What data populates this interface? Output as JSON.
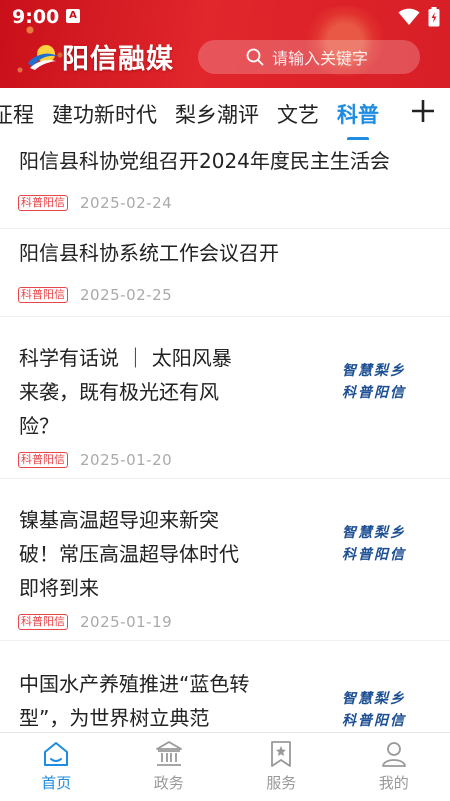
{
  "status_bar": {
    "time": "9:00",
    "notification_badge": "A"
  },
  "header": {
    "app_name": "阳信融媒",
    "search_placeholder": "请输入关键字",
    "brand_color": "#d81e26"
  },
  "tabs": {
    "items": [
      {
        "label": "征程",
        "active": false
      },
      {
        "label": "建功新时代",
        "active": false
      },
      {
        "label": "梨乡潮评",
        "active": false
      },
      {
        "label": "文艺",
        "active": false
      },
      {
        "label": "科普",
        "active": true
      }
    ],
    "add_icon": "plus-icon",
    "accent_color": "#1e8ce0"
  },
  "news": [
    {
      "title_lines": [
        "阳信县科协党组召开2024年度民主生活会"
      ],
      "tag": "科普阳信",
      "date": "2025-02-24",
      "thumbnail": null
    },
    {
      "title_lines": [
        "阳信县科协系统工作会议召开"
      ],
      "tag": "科普阳信",
      "date": "2025-02-25",
      "thumbnail": null
    },
    {
      "title_lines": [
        "科学有话说 ｜ 太阳风暴",
        "来袭，既有极光还有风",
        "险？"
      ],
      "tag": "科普阳信",
      "date": "2025-01-20",
      "thumbnail": [
        "智慧梨乡",
        "科普阳信"
      ]
    },
    {
      "title_lines": [
        "镍基高温超导迎来新突",
        "破！常压高温超导体时代",
        "即将到来"
      ],
      "tag": "科普阳信",
      "date": "2025-01-19",
      "thumbnail": [
        "智慧梨乡",
        "科普阳信"
      ]
    },
    {
      "title_lines": [
        "中国水产养殖推进“蓝色转",
        "型”，为世界树立典范"
      ],
      "tag": "",
      "date": "",
      "thumbnail": [
        "智慧梨乡",
        "科普阳信"
      ]
    }
  ],
  "bottom_nav": {
    "items": [
      {
        "label": "首页",
        "icon": "home-icon",
        "active": true
      },
      {
        "label": "政务",
        "icon": "government-icon",
        "active": false
      },
      {
        "label": "服务",
        "icon": "bookmark-icon",
        "active": false
      },
      {
        "label": "我的",
        "icon": "user-icon",
        "active": false
      }
    ]
  }
}
